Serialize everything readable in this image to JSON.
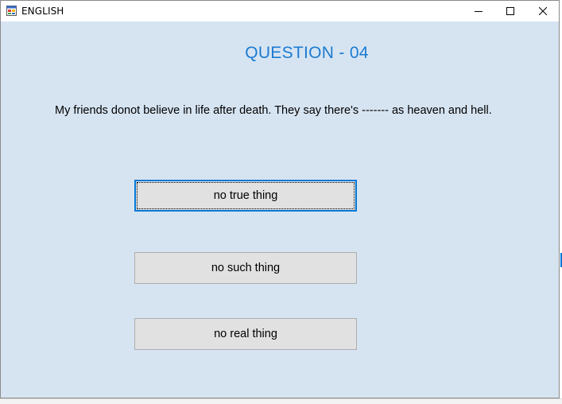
{
  "window": {
    "title": "ENGLISH",
    "icon": "windows-form-app-icon",
    "controls": {
      "minimize": "minimize-icon",
      "maximize": "maximize-icon",
      "close": "close-icon"
    }
  },
  "quiz": {
    "heading": "QUESTION - 04",
    "question": "My friends donot believe in life after death. They say there's ------- as heaven and hell.",
    "options": [
      {
        "label": "no true thing"
      },
      {
        "label": "no such thing"
      },
      {
        "label": "no real thing"
      }
    ]
  },
  "colors": {
    "client_background": "#d6e4f2",
    "heading": "#1b7bd1",
    "button_face": "#e1e1e1",
    "focus_border": "#0078d7"
  }
}
